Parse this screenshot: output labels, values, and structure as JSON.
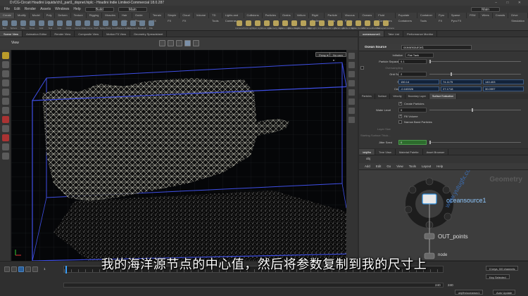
{
  "window": {
    "title": "D:/CG-Circuit Houdini Liquids/ch1_part1_dopnet.hiplc - Houdini Indie Limited-Commercial 18.0.287",
    "controls": [
      "–",
      "□",
      "✕"
    ]
  },
  "menubar": {
    "items": [
      "File",
      "Edit",
      "Render",
      "Assets",
      "Windows",
      "Help"
    ],
    "desktop": "Build",
    "context": "Main",
    "right_desktop": "Main"
  },
  "shelf": {
    "tabs": [
      "Create",
      "Modify",
      "Model",
      "Poly",
      "Deform",
      "Texture",
      "Rigging",
      "Muscles",
      "Hair Utils",
      "Guide Process",
      "Terrain FX",
      "Simple FX",
      "Cloud FX",
      "Volume",
      "TD Tools",
      "Lights and Cameras",
      "Collisions",
      "Particles",
      "Grains",
      "Vellum",
      "Rigid Bodies",
      "Particle Fluids",
      "Viscous Fluids",
      "Oceans",
      "Fluid Containers",
      "Populate Containers",
      "Container Tools",
      "Pyro FX",
      "Sparse Pyro FX",
      "FEM",
      "Wires",
      "Crowds",
      "Drive Simulation"
    ],
    "tools": [
      "Box",
      "Sphere",
      "Tube",
      "Torus",
      "Grid",
      "Null",
      "Line",
      "Circle",
      "Curve",
      "Draw Curve",
      "Path",
      "Spray Paint",
      "Font",
      "Platonic Solids",
      "L-System",
      "Metaball",
      "File"
    ],
    "right_tools": [
      "Camera",
      "Point Light",
      "Spot Light",
      "Area Light",
      "Geometry Light",
      "Volume Light",
      "Distant Light",
      "Environment Light",
      "Sky Light",
      "GI Light",
      "Caustic Light",
      "Portal Light",
      "Ambient Light",
      "Stereo Camera",
      "VR Camera",
      "Switcher",
      "Gamepad Camera"
    ]
  },
  "left_pane": {
    "tabs": [
      "Scene View",
      "Animation Editor",
      "Render View",
      "Composite View",
      "Motion FX View",
      "Geometry Spreadsheet"
    ],
    "view_label": "View",
    "persp": "Persp ▾",
    "cam": "No cam ▾"
  },
  "param_pane": {
    "tabs": [
      "oceansource1",
      "Take List",
      "Performance Monitor"
    ],
    "node_type": "Ocean Source",
    "node_name": "oceansource1",
    "rows": [
      {
        "label": "Initialize",
        "value": "Flat Tank"
      },
      {
        "label": "Particle Separation",
        "value": "0.1"
      },
      {
        "label": "Oversampling",
        "value": ""
      },
      {
        "label": "Grid Scale",
        "value": "2"
      },
      {
        "label": "Size",
        "values": [
          "150.14",
          "74.1175",
          "140.403"
        ]
      },
      {
        "label": "Center",
        "values": [
          "-0.163326",
          "27.1718",
          "30.0997"
        ]
      }
    ],
    "subtabs": [
      "Particles",
      "Surface",
      "Velocity",
      "Boundary Layer",
      "Surface Evaluation"
    ],
    "active_subtab": "Surface Evaluation",
    "create_particles": "Create Particles",
    "water_level_label": "Water Level",
    "water_level": "0",
    "fill_volume": "Fill Volume",
    "narrow_band": "Narrow Band Particles",
    "layer_size_label": "Layer Size",
    "surface_thickness_label": "Starting Surface Thick...",
    "jitter_seed_label": "Jitter Seed",
    "jitter_seed": "0"
  },
  "network_pane": {
    "tabs": [
      "/obj/fm",
      "Tree View",
      "Material Palette",
      "Asset Browser"
    ],
    "path": "obj",
    "menu": [
      "Add",
      "Edit",
      "Go",
      "View",
      "Tools",
      "Layout",
      "Help"
    ],
    "context_label": "Geometry",
    "node_selected": "oceansource1",
    "node_out": "OUT_points",
    "node_extra": "node",
    "watermark": "www.yutugfx.com"
  },
  "timeline": {
    "current_frame": "1",
    "start": "1",
    "start2": "1",
    "end": "240",
    "end2": "240",
    "keys_info": "0 keys, 0/0 channels",
    "key_all": "Key Selected",
    "auto_update": "Auto Update",
    "frame_label": "obj/fm/oceansrc1"
  },
  "subtitle": "我的海洋源节点的中心值，然后将参数复制到我的尺寸上",
  "colors": {
    "bbox": "#3f4fe6",
    "particles": "#d8d8c8",
    "accent": "#3aa0ff"
  }
}
